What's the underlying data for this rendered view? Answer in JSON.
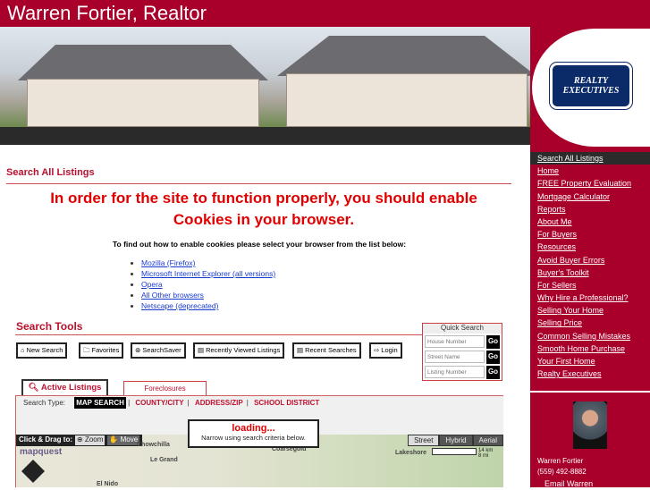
{
  "site": {
    "title": "Warren Fortier, Realtor",
    "logo_text": "REALTY EXECUTIVES"
  },
  "page": {
    "heading": "Search All Listings",
    "warning": "In order for the site to function properly, you should enable Cookies in your browser.",
    "instructions": "To find out how to enable cookies please select your browser from the list below:",
    "browsers": [
      "Mozilla (Firefox)",
      "Microsoft Internet Explorer (all versions)",
      "Opera",
      "All Other browsers",
      "Netscape (deprecated)"
    ]
  },
  "search_tools": {
    "heading": "Search Tools",
    "buttons": [
      {
        "label": "New Search",
        "icon": "house-icon"
      },
      {
        "label": "Favorites",
        "icon": "folder-icon"
      },
      {
        "label": "SearchSaver",
        "icon": "lifebuoy-icon"
      },
      {
        "label": "Recently Viewed Listings",
        "icon": "document-icon"
      },
      {
        "label": "Recent Searches",
        "icon": "document-icon"
      },
      {
        "label": "Login",
        "icon": "arrow-right-icon"
      }
    ]
  },
  "quick_search": {
    "title": "Quick Search",
    "fields": [
      {
        "placeholder": "House Number"
      },
      {
        "placeholder": "Street Name"
      },
      {
        "placeholder": "Listing Number"
      }
    ],
    "go": "Go"
  },
  "tabs": [
    {
      "label": "Active Listings",
      "active": true
    },
    {
      "label": "Foreclosures",
      "active": false
    }
  ],
  "search_type": {
    "label": "Search Type:",
    "options": [
      "MAP SEARCH",
      "COUNTY/CITY",
      "ADDRESS/ZIP",
      "SCHOOL DISTRICT"
    ],
    "selected": "MAP SEARCH"
  },
  "loading": {
    "title": "loading...",
    "message": "Narrow using search criteria below."
  },
  "map": {
    "drag_label": "Click & Drag to:",
    "zoom": "Zoom",
    "move": "Move",
    "types": [
      "Street",
      "Hybrid",
      "Aerial"
    ],
    "selected_type": "Street",
    "brand": "mapquest",
    "towns": [
      "Chowchilla",
      "Le Grand",
      "El Nido",
      "Coarsegold",
      "Lakeshore"
    ],
    "scale": [
      "14 km",
      "8 mi"
    ]
  },
  "sidebar": {
    "items": [
      "Search All Listings",
      "Home",
      "FREE Property Evaluation",
      "Mortgage Calculator",
      "Reports",
      "About Me",
      "For Buyers",
      "Resources",
      "Avoid Buyer Errors",
      "Buyer's Toolkit",
      "For Sellers",
      "Why Hire a Professional?",
      "Selling Your Home",
      "Selling Price",
      "Common Selling Mistakes",
      "Smooth Home Purchase",
      "Your First Home",
      "Realty Executives"
    ],
    "agent": {
      "name": "Warren Fortier",
      "phone": "(559) 492-8882",
      "email_label": "Email Warren"
    }
  },
  "colors": {
    "brand_red": "#a8002a",
    "logo_blue": "#0b2a68",
    "warning_red": "#e00000"
  }
}
